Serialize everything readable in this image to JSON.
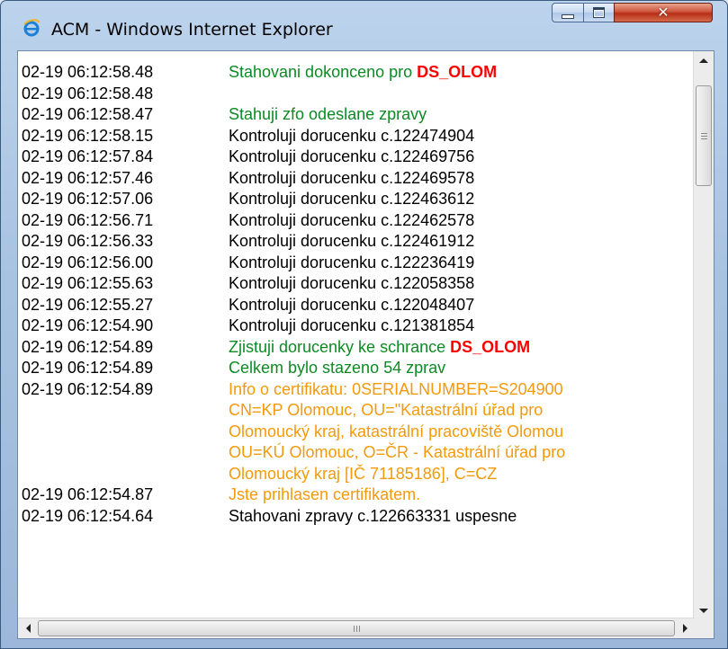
{
  "window": {
    "title": "ACM - Windows Internet Explorer",
    "icon": "ie-icon",
    "controls": {
      "minimize": "minimize-icon",
      "maximize": "maximize-icon",
      "close": "✕"
    }
  },
  "colors": {
    "timestamp": "#000000",
    "normal": "#000000",
    "success": "#0d8a24",
    "info": "#f39a0b",
    "highlight": "#ff0000"
  },
  "log": [
    {
      "ts": "02-19 06:12:58.48",
      "kind": "green",
      "lines": [
        {
          "text": "Stahovani dokonceno pro ",
          "ds": "DS_OLOM"
        }
      ]
    },
    {
      "ts": "02-19 06:12:58.48",
      "kind": "black",
      "lines": [
        {
          "text": ""
        }
      ]
    },
    {
      "ts": "02-19 06:12:58.47",
      "kind": "green",
      "lines": [
        {
          "text": "Stahuji zfo odeslane zpravy"
        }
      ]
    },
    {
      "ts": "02-19 06:12:58.15",
      "kind": "black",
      "lines": [
        {
          "text": "Kontroluji dorucenku c.122474904"
        }
      ]
    },
    {
      "ts": "02-19 06:12:57.84",
      "kind": "black",
      "lines": [
        {
          "text": "Kontroluji dorucenku c.122469756"
        }
      ]
    },
    {
      "ts": "02-19 06:12:57.46",
      "kind": "black",
      "lines": [
        {
          "text": "Kontroluji dorucenku c.122469578"
        }
      ]
    },
    {
      "ts": "02-19 06:12:57.06",
      "kind": "black",
      "lines": [
        {
          "text": "Kontroluji dorucenku c.122463612"
        }
      ]
    },
    {
      "ts": "02-19 06:12:56.71",
      "kind": "black",
      "lines": [
        {
          "text": "Kontroluji dorucenku c.122462578"
        }
      ]
    },
    {
      "ts": "02-19 06:12:56.33",
      "kind": "black",
      "lines": [
        {
          "text": "Kontroluji dorucenku c.122461912"
        }
      ]
    },
    {
      "ts": "02-19 06:12:56.00",
      "kind": "black",
      "lines": [
        {
          "text": "Kontroluji dorucenku c.122236419"
        }
      ]
    },
    {
      "ts": "02-19 06:12:55.63",
      "kind": "black",
      "lines": [
        {
          "text": "Kontroluji dorucenku c.122058358"
        }
      ]
    },
    {
      "ts": "02-19 06:12:55.27",
      "kind": "black",
      "lines": [
        {
          "text": "Kontroluji dorucenku c.122048407"
        }
      ]
    },
    {
      "ts": "02-19 06:12:54.90",
      "kind": "black",
      "lines": [
        {
          "text": "Kontroluji dorucenku c.121381854"
        }
      ]
    },
    {
      "ts": "02-19 06:12:54.89",
      "kind": "green",
      "lines": [
        {
          "text": "Zjistuji dorucenky ke schrance ",
          "ds": "DS_OLOM"
        }
      ]
    },
    {
      "ts": "02-19 06:12:54.89",
      "kind": "green",
      "lines": [
        {
          "text": "Celkem bylo stazeno 54 zprav"
        }
      ]
    },
    {
      "ts": "02-19 06:12:54.89",
      "kind": "orange",
      "lines": [
        {
          "text": "Info o certifikatu: 0SERIALNUMBER=S204900"
        },
        {
          "text": "CN=KP Olomouc, OU=\"Katastrální úřad pro"
        },
        {
          "text": "Olomoucký kraj, katastrální pracoviště Olomou"
        },
        {
          "text": "OU=KÚ Olomouc, O=ČR - Katastrální úřad pro"
        },
        {
          "text": "Olomoucký kraj [IČ 71185186], C=CZ"
        }
      ]
    },
    {
      "ts": "02-19 06:12:54.87",
      "kind": "orange",
      "lines": [
        {
          "text": "Jste prihlasen certifikatem."
        }
      ]
    },
    {
      "ts": "02-19 06:12:54.64",
      "kind": "black",
      "lines": [
        {
          "text": "Stahovani zpravy c.122663331 uspesne"
        }
      ]
    }
  ],
  "scrollbar": {
    "vertical": {
      "up": "scroll-up-arrow",
      "down": "scroll-down-arrow",
      "thumb_position": 0.0
    },
    "horizontal": {
      "left": "scroll-left-arrow",
      "right": "scroll-right-arrow",
      "thumb_label": "III"
    }
  }
}
